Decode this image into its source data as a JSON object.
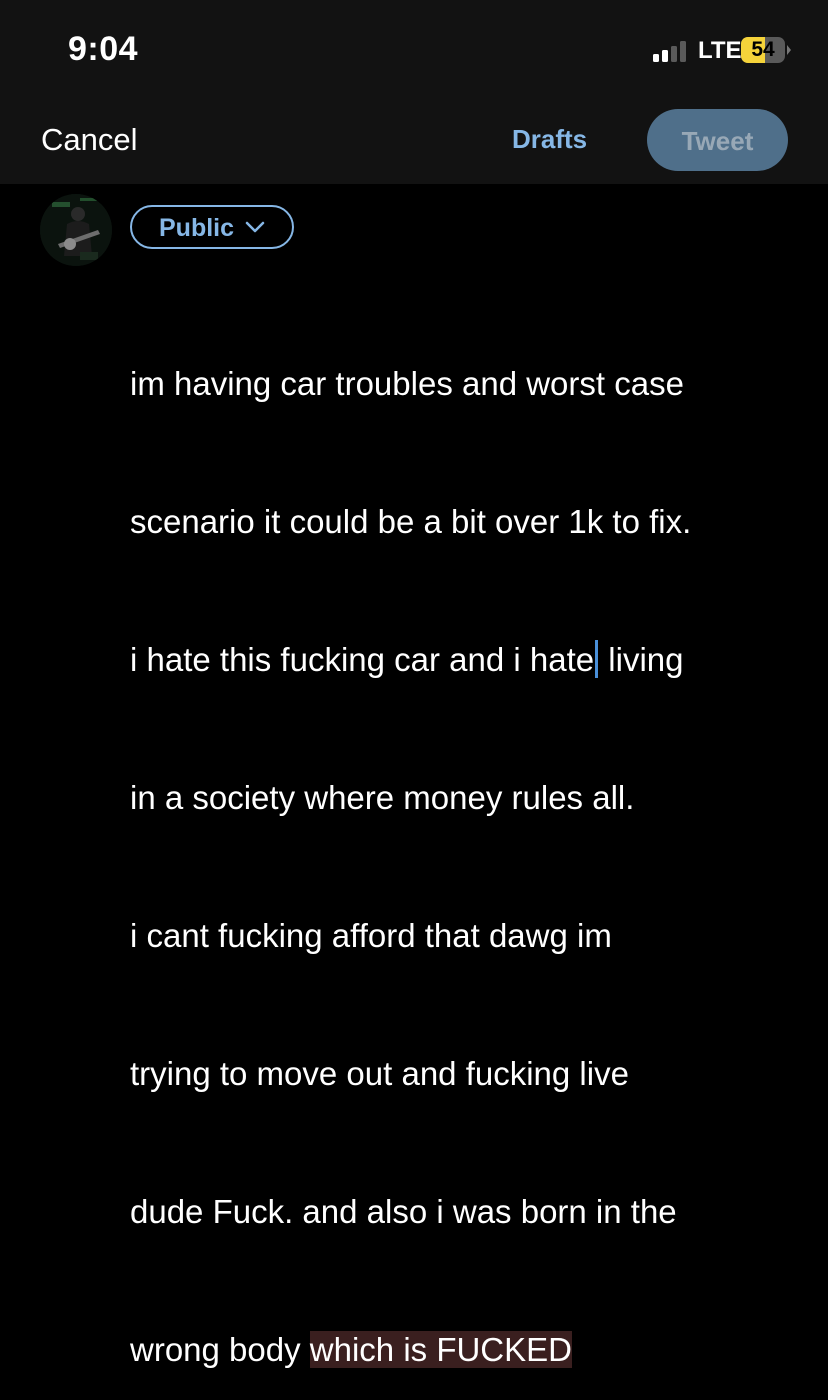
{
  "status_bar": {
    "time": "9:04",
    "network": "LTE",
    "battery": "54",
    "battery_level_percent": 54,
    "signal_bars_filled": 2,
    "signal_bars_total": 4
  },
  "header": {
    "cancel_label": "Cancel",
    "drafts_label": "Drafts",
    "tweet_label": "Tweet"
  },
  "audience": {
    "label": "Public"
  },
  "compose": {
    "lines": [
      "im having car troubles and worst case",
      "scenario it could be a bit over 1k to fix.",
      "i hate this fucking car and i hate",
      " living",
      "in a society where money rules all.",
      "i cant fucking afford that dawg im",
      "trying to move out and fucking live",
      "dude Fuck. and also i was born in the",
      "wrong body ",
      "which is FUCKED"
    ]
  },
  "colors": {
    "accent": "#86b7e6",
    "tweet_button_bg": "#4f6f8a",
    "battery_fill": "#f5d33a",
    "highlight": "#3a1f1f"
  }
}
